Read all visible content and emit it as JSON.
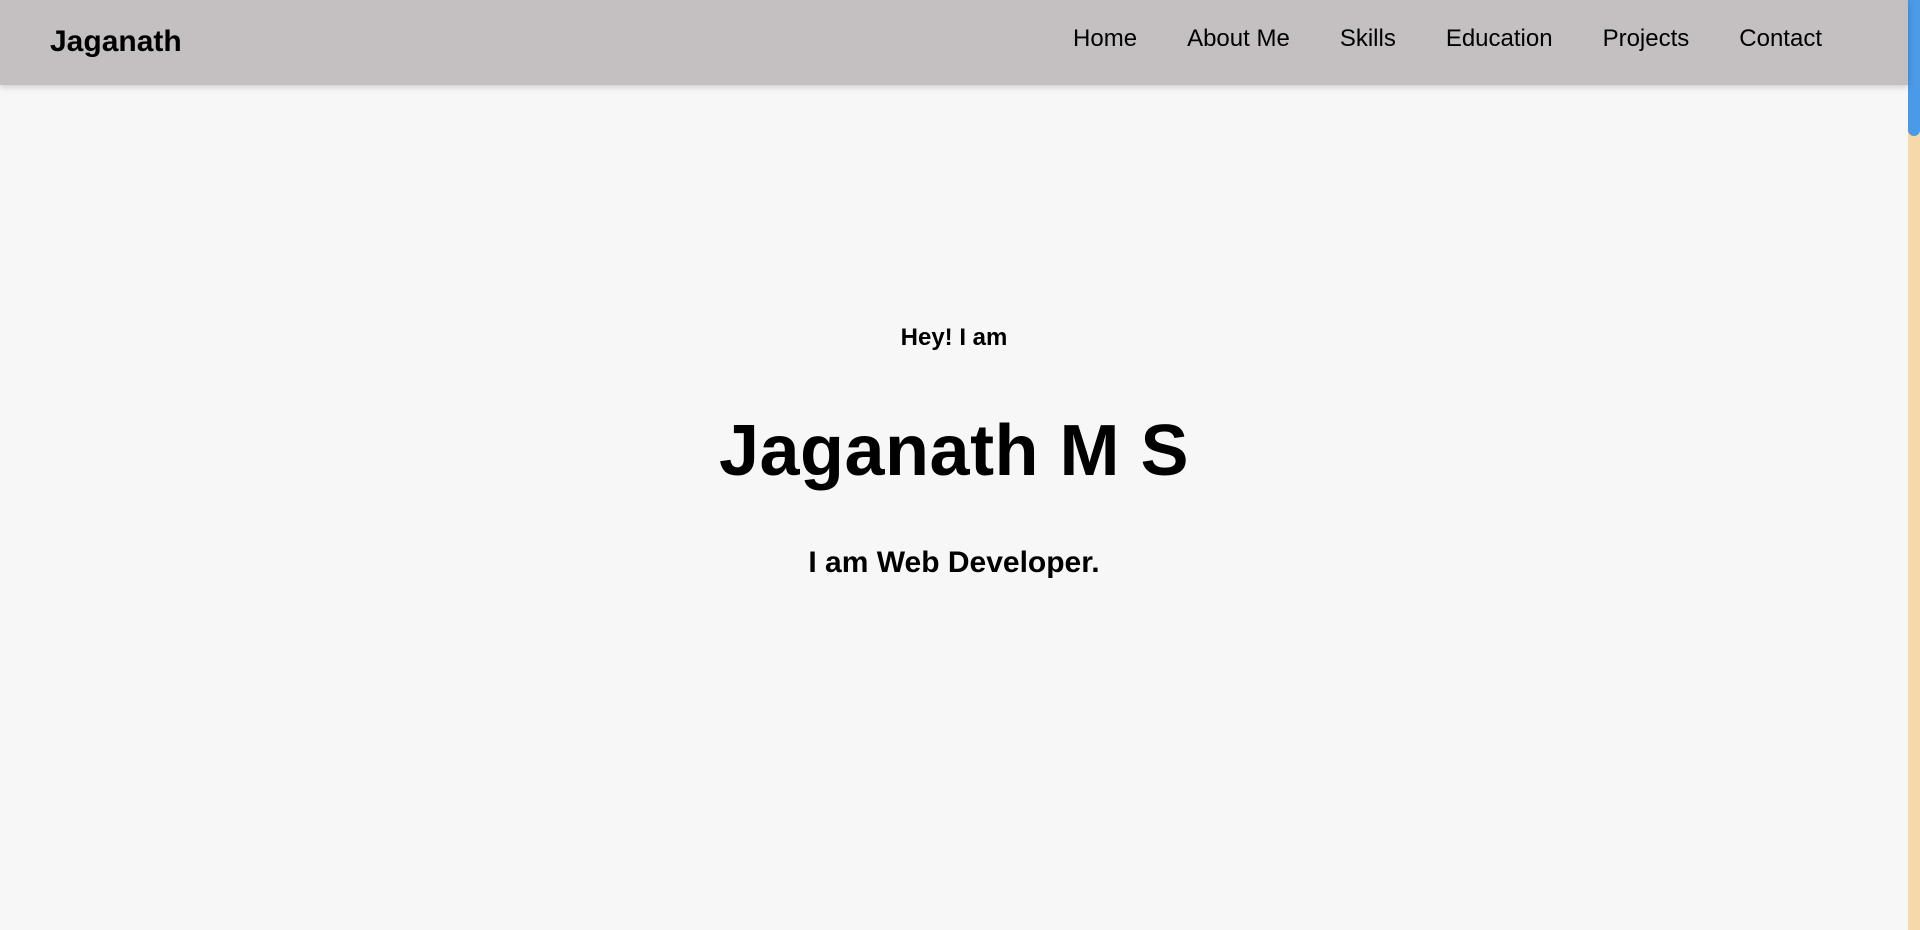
{
  "navbar": {
    "brand": "Jaganath",
    "links": [
      {
        "label": "Home"
      },
      {
        "label": "About Me"
      },
      {
        "label": "Skills"
      },
      {
        "label": "Education"
      },
      {
        "label": "Projects"
      },
      {
        "label": "Contact"
      }
    ]
  },
  "hero": {
    "greeting": "Hey! I am",
    "name": "Jaganath M S",
    "role": "I am Web Developer."
  },
  "colors": {
    "navbar_bg": "#c4bfc0",
    "page_bg": "#f7f7f7",
    "scrollbar_thumb": "#4a9ae8",
    "scrollbar_track": "#f5d9a8"
  }
}
